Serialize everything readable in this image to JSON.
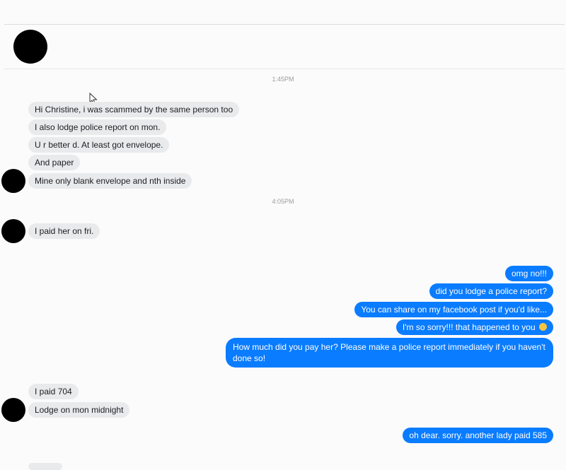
{
  "conversation": {
    "groups": [
      {
        "time": "1:45PM",
        "incoming": [
          "Hi Christine, i was scammed by the same person too",
          "I also lodge police report on mon.",
          "U r better d. At least got envelope.",
          "And paper",
          "Mine only blank envelope and nth inside"
        ]
      },
      {
        "time": "4:05PM",
        "incoming": [
          "I paid her on fri."
        ],
        "outgoing": [
          "omg no!!!",
          "did you lodge a police report?",
          "You can share on my facebook post if you'd like...",
          "I'm so sorry!!! that happened to you",
          "How much did you pay her? Please make a police report immediately if you haven't done so!"
        ]
      },
      {
        "incoming": [
          "I paid 704",
          "Lodge on mon midnight"
        ],
        "outgoing": [
          "oh dear. sorry. another lady paid 585"
        ]
      }
    ]
  },
  "icons": {
    "pointer": "cursor-arrow-icon",
    "sad_emoji": "sad-face-emoji-icon"
  },
  "colors": {
    "outgoing_bubble": "#0a7cff",
    "incoming_bubble": "#e9eaec",
    "avatar": "#000000"
  }
}
